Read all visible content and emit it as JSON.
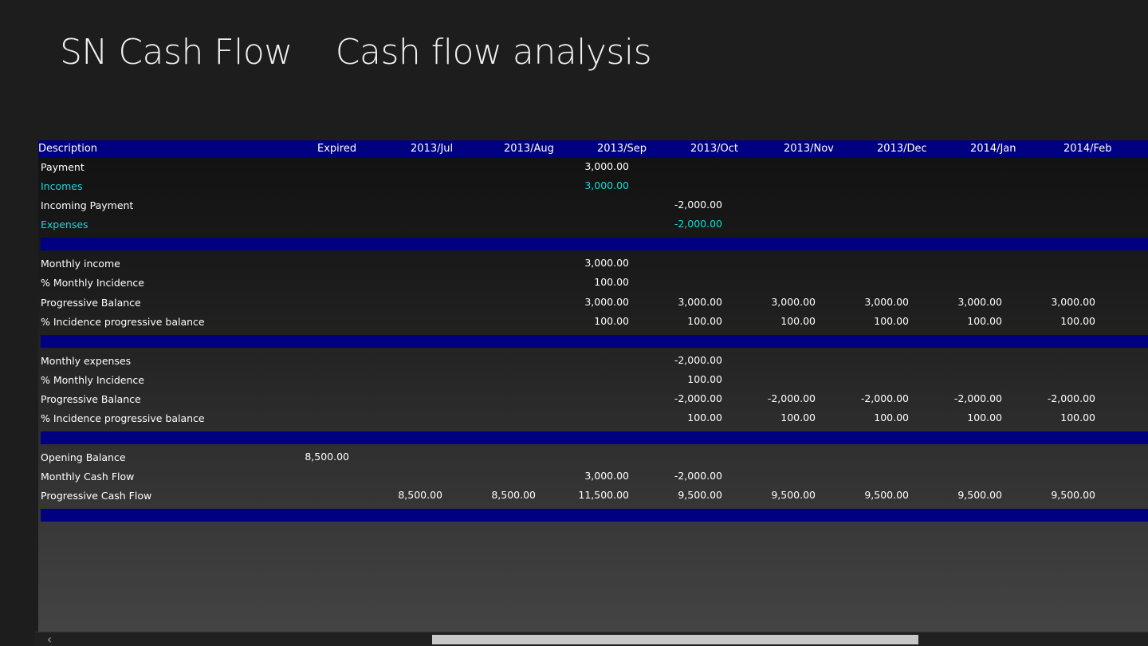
{
  "app": {
    "title": "SN Cash Flow",
    "page_title": "Cash flow analysis"
  },
  "grid": {
    "columns": [
      "Description",
      "Expired",
      "2013/Jul",
      "2013/Aug",
      "2013/Sep",
      "2013/Oct",
      "2013/Nov",
      "2013/Dec",
      "2014/Jan",
      "2014/Feb"
    ],
    "rows": [
      {
        "label": "Payment",
        "values": [
          "",
          "",
          "",
          "3,000.00",
          "",
          "",
          "",
          "",
          ""
        ]
      },
      {
        "label": "Incomes",
        "values": [
          "",
          "",
          "",
          "3,000.00",
          "",
          "",
          "",
          "",
          ""
        ]
      },
      {
        "label": "Incoming Payment",
        "values": [
          "",
          "",
          "",
          "",
          "-2,000.00",
          "",
          "",
          "",
          ""
        ]
      },
      {
        "label": "Expenses",
        "values": [
          "",
          "",
          "",
          "",
          "-2,000.00",
          "",
          "",
          "",
          ""
        ]
      },
      {
        "label": "Monthly income",
        "values": [
          "",
          "",
          "",
          "3,000.00",
          "",
          "",
          "",
          "",
          ""
        ]
      },
      {
        "label": "% Monthly Incidence",
        "values": [
          "",
          "",
          "",
          "100.00",
          "",
          "",
          "",
          "",
          ""
        ]
      },
      {
        "label": "Progressive Balance",
        "values": [
          "",
          "",
          "",
          "3,000.00",
          "3,000.00",
          "3,000.00",
          "3,000.00",
          "3,000.00",
          "3,000.00"
        ]
      },
      {
        "label": "% Incidence progressive balance",
        "values": [
          "",
          "",
          "",
          "100.00",
          "100.00",
          "100.00",
          "100.00",
          "100.00",
          "100.00"
        ]
      },
      {
        "label": "Monthly expenses",
        "values": [
          "",
          "",
          "",
          "",
          "-2,000.00",
          "",
          "",
          "",
          ""
        ]
      },
      {
        "label": "% Monthly Incidence",
        "values": [
          "",
          "",
          "",
          "",
          "100.00",
          "",
          "",
          "",
          ""
        ]
      },
      {
        "label": "Progressive Balance",
        "values": [
          "",
          "",
          "",
          "",
          "-2,000.00",
          "-2,000.00",
          "-2,000.00",
          "-2,000.00",
          "-2,000.00"
        ]
      },
      {
        "label": "% Incidence progressive balance",
        "values": [
          "",
          "",
          "",
          "",
          "100.00",
          "100.00",
          "100.00",
          "100.00",
          "100.00"
        ]
      },
      {
        "label": "Opening Balance",
        "values": [
          "8,500.00",
          "",
          "",
          "",
          "",
          "",
          "",
          "",
          ""
        ]
      },
      {
        "label": "Monthly Cash Flow",
        "values": [
          "",
          "",
          "",
          "3,000.00",
          "-2,000.00",
          "",
          "",
          "",
          ""
        ]
      },
      {
        "label": "Progressive Cash Flow",
        "values": [
          "",
          "8,500.00",
          "8,500.00",
          "11,500.00",
          "9,500.00",
          "9,500.00",
          "9,500.00",
          "9,500.00",
          "9,500.00"
        ]
      }
    ]
  },
  "colors": {
    "header_bg": "#000080",
    "highlight_text": "#17d7d7",
    "separator": "#000080"
  },
  "icons": {
    "scroll_left": "chevron-left-icon"
  }
}
